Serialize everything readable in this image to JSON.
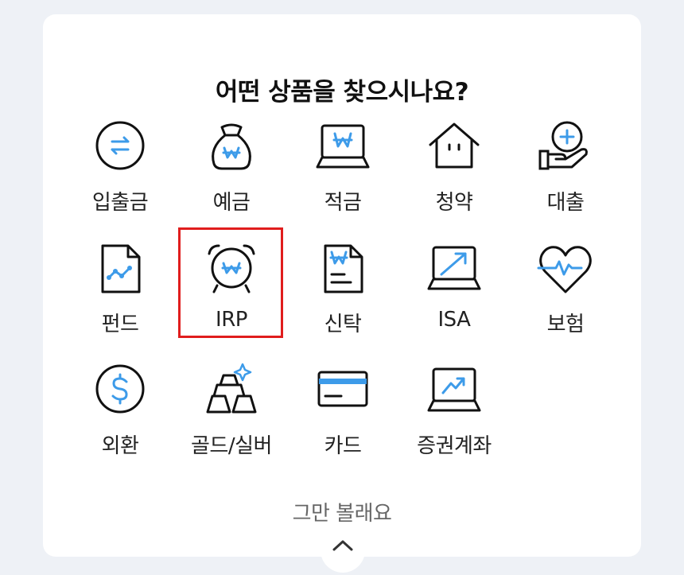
{
  "title": "어떤 상품을 찾으시나요?",
  "products": [
    {
      "label": "입출금",
      "icon": "transfer-arrows-icon"
    },
    {
      "label": "예금",
      "icon": "money-bag-icon"
    },
    {
      "label": "적금",
      "icon": "laptop-won-icon"
    },
    {
      "label": "청약",
      "icon": "house-icon"
    },
    {
      "label": "대출",
      "icon": "hand-plus-icon"
    },
    {
      "label": "펀드",
      "icon": "document-chart-icon"
    },
    {
      "label": "IRP",
      "icon": "alarm-clock-won-icon"
    },
    {
      "label": "신탁",
      "icon": "document-won-icon"
    },
    {
      "label": "ISA",
      "icon": "laptop-arrow-icon"
    },
    {
      "label": "보험",
      "icon": "heart-pulse-icon"
    },
    {
      "label": "외환",
      "icon": "dollar-coin-icon"
    },
    {
      "label": "골드/실버",
      "icon": "gold-bars-icon"
    },
    {
      "label": "카드",
      "icon": "credit-card-icon"
    },
    {
      "label": "증권계좌",
      "icon": "laptop-trend-icon"
    }
  ],
  "selected": "IRP",
  "dismiss_label": "그만 볼래요",
  "toggle_icon": "chevron-up-icon",
  "colors": {
    "background": "#eef1f6",
    "card": "#ffffff",
    "accent": "#3d9be9",
    "stroke": "#111111",
    "highlight": "#e01d1d"
  }
}
